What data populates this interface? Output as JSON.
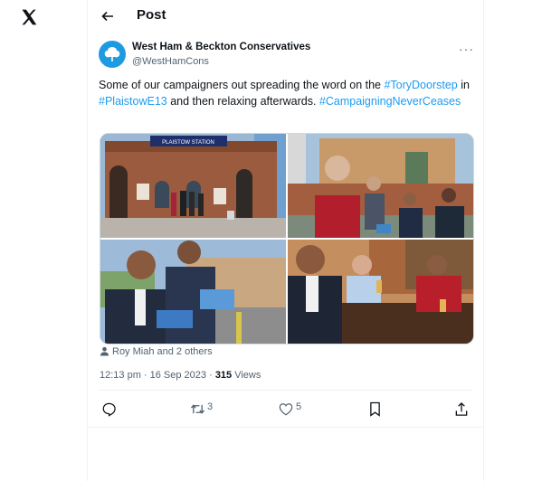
{
  "header": {
    "title": "Post"
  },
  "tweet": {
    "author_name": "West Ham & Beckton Conservatives",
    "author_handle": "@WestHamCons",
    "text_parts": [
      "Some of our campaigners out spreading the word on the ",
      "#ToryDoorstep",
      " in ",
      "#PlaistowE13",
      " and then relaxing afterwards. ",
      "#CampaigningNeverCeases"
    ],
    "photo_sign": "PLAISTOW STATION",
    "tagged_people": "Roy Miah and 2 others",
    "time": "12:13 pm · 16 Sep 2023 · ",
    "views_count": "315",
    "views_label": " Views"
  },
  "actions": {
    "reply_count": "",
    "retweet_count": "3",
    "like_count": "5"
  },
  "colors": {
    "link": "#1d9bf0",
    "muted": "#536471",
    "avatar": "#1e9be0"
  },
  "icons": [
    "x-logo-icon",
    "back-arrow-icon",
    "more-icon",
    "person-icon",
    "reply-icon",
    "retweet-icon",
    "like-icon",
    "bookmark-icon",
    "share-icon"
  ]
}
